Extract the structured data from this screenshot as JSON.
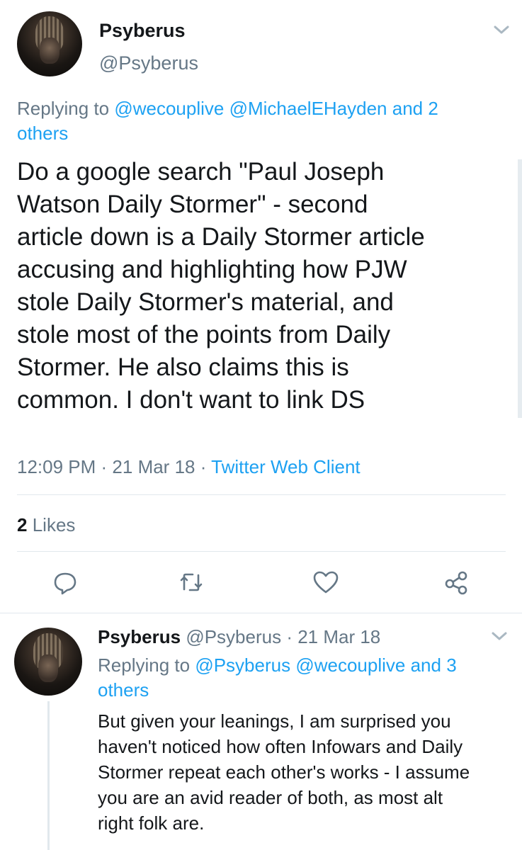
{
  "main": {
    "author_name": "Psyberus",
    "author_handle": "@Psyberus",
    "replying_prefix": "Replying to ",
    "replying_mentions": [
      "@wecouplive",
      "@MichaelEHayden"
    ],
    "replying_and": "and 2",
    "replying_others": "others",
    "text_lines": [
      "Do a google search \"Paul Joseph",
      "Watson Daily Stormer\" - second",
      "article down is a Daily Stormer article",
      "accusing and highlighting how PJW",
      "stole Daily Stormer's material, and",
      "stole most of the points from Daily",
      "Stormer. He also claims this is",
      "common. I don't want to link DS"
    ],
    "time": "12:09 PM",
    "date": "21 Mar 18",
    "client": "Twitter Web Client",
    "likes_count": "2",
    "likes_label": "Likes"
  },
  "reply": {
    "author_name": "Psyberus",
    "author_handle": "@Psyberus",
    "date": "21 Mar 18",
    "replying_prefix": "Replying to ",
    "replying_mentions": [
      "@Psyberus",
      "@wecouplive"
    ],
    "replying_and": "and 3",
    "replying_others": "others",
    "text_lines": [
      "But given your leanings, I am surprised you",
      "haven't noticed how often Infowars and Daily",
      "Stormer repeat each other's works -  I assume",
      "you are an avid reader of both, as most alt",
      "right folk are."
    ]
  },
  "icons": {
    "menu": "chevron-down-icon",
    "reply": "reply-icon",
    "retweet": "retweet-icon",
    "like": "heart-icon",
    "share": "share-icon"
  },
  "colors": {
    "link": "#1da1f2",
    "secondary": "#657786",
    "text": "#14171a",
    "divider": "#e1e8ed"
  }
}
